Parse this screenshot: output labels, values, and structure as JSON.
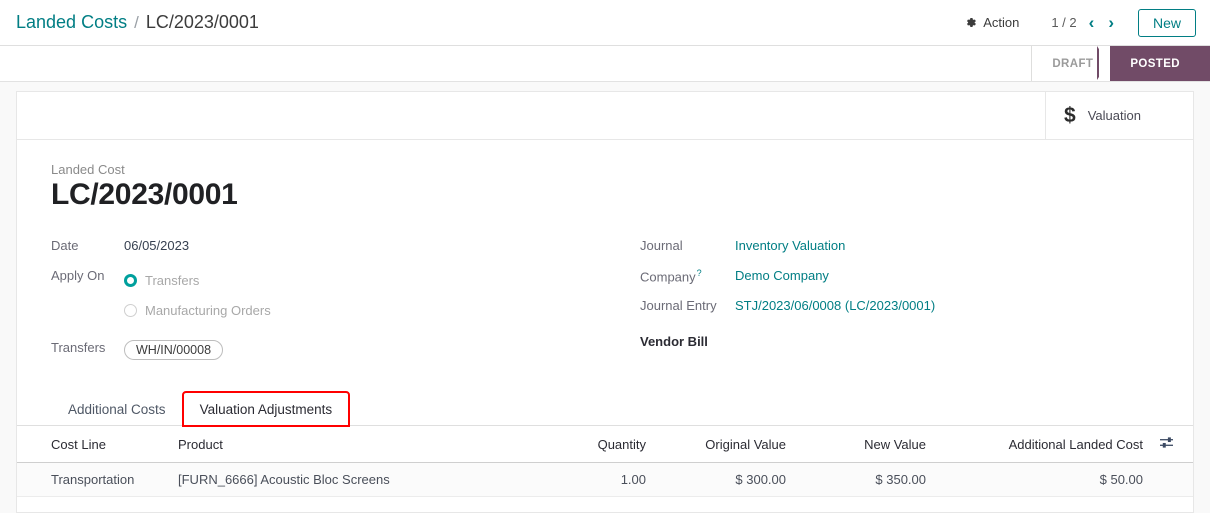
{
  "breadcrumb": {
    "parent": "Landed Costs",
    "separator": "/",
    "current": "LC/2023/0001"
  },
  "control_panel": {
    "action_label": "Action",
    "action_icon": "gear-icon",
    "pager_value": "1 / 2",
    "pager_prev_icon": "‹",
    "pager_next_icon": "›",
    "new_label": "New"
  },
  "statusbar": {
    "states": [
      {
        "label": "DRAFT",
        "active": false
      },
      {
        "label": "POSTED",
        "active": true
      }
    ],
    "active_color": "#714b67",
    "inactive_color": "#9b9b9b"
  },
  "stat_buttons": [
    {
      "icon": "dollar-icon",
      "icon_glyph": "$",
      "label": "Valuation"
    }
  ],
  "record": {
    "title_caption": "Landed Cost",
    "title": "LC/2023/0001",
    "fields": {
      "date_label": "Date",
      "date_value": "06/05/2023",
      "apply_on_label": "Apply On",
      "apply_on_options": [
        {
          "label": "Transfers",
          "selected": true
        },
        {
          "label": "Manufacturing Orders",
          "selected": false
        }
      ],
      "transfers_label": "Transfers",
      "transfers_tags": [
        "WH/IN/00008"
      ],
      "journal_label": "Journal",
      "journal_value": "Inventory Valuation",
      "company_label": "Company",
      "company_help": "?",
      "company_value": "Demo Company",
      "journal_entry_label": "Journal Entry",
      "journal_entry_value": "STJ/2023/06/0008 (LC/2023/0001)",
      "vendor_bill_label": "Vendor Bill",
      "vendor_bill_value": ""
    }
  },
  "notebook": {
    "tabs": [
      {
        "label": "Additional Costs",
        "active": false,
        "annotated": false
      },
      {
        "label": "Valuation Adjustments",
        "active": true,
        "annotated": true
      }
    ],
    "annotation_color": "#ff0000"
  },
  "table": {
    "columns": [
      {
        "label": "Cost Line",
        "align": "left"
      },
      {
        "label": "Product",
        "align": "left"
      },
      {
        "label": "Quantity",
        "align": "right"
      },
      {
        "label": "Original Value",
        "align": "right"
      },
      {
        "label": "New Value",
        "align": "right"
      },
      {
        "label": "Additional Landed Cost",
        "align": "right"
      }
    ],
    "optional_columns_icon": "sliders-icon",
    "rows": [
      {
        "cost_line": "Transportation",
        "product": "[FURN_6666] Acoustic Bloc Screens",
        "quantity": "1.00",
        "original_value": "$ 300.00",
        "new_value": "$ 350.00",
        "additional_landed_cost": "$ 50.00"
      }
    ]
  },
  "theme": {
    "accent_teal": "#017e84",
    "brand_purple": "#714b67",
    "radio_teal": "#00a09d",
    "sheet_bg": "#f9f9f9"
  }
}
